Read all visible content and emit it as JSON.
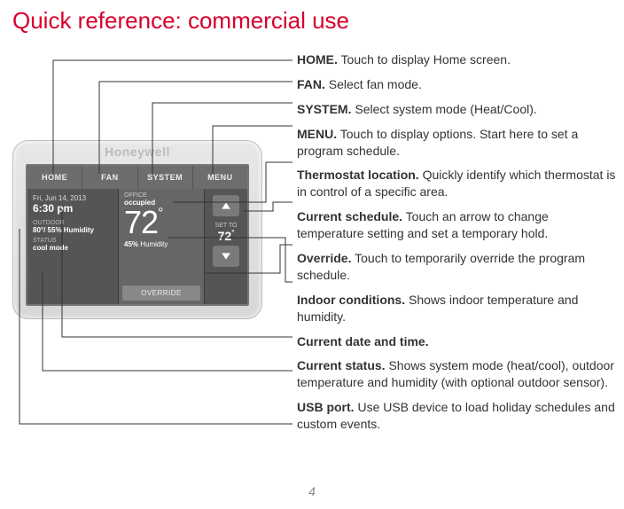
{
  "title": "Quick reference: commercial use",
  "page_number": "4",
  "device": {
    "brand": "Honeywell",
    "tabs": {
      "home": "HOME",
      "fan": "FAN",
      "system": "SYSTEM",
      "menu": "MENU"
    },
    "datetime": {
      "date": "Fri, Jun 14, 2013",
      "time": "6:30 pm"
    },
    "outdoor": {
      "label": "OUTDOOR",
      "value": "80°/ 55% Humidity"
    },
    "status": {
      "label": "STATUS",
      "value": "cool mode"
    },
    "location": {
      "label": "OFFICE",
      "value": "occupied"
    },
    "indoor_temp": "72",
    "humidity": {
      "value": "45%",
      "label": "Humidity"
    },
    "override": "OVERRIDE",
    "set_to": {
      "label": "SET TO",
      "value": "72"
    }
  },
  "descriptions": {
    "home": {
      "bold": "HOME.",
      "text": " Touch to display Home screen."
    },
    "fan": {
      "bold": "FAN.",
      "text": " Select fan mode."
    },
    "system": {
      "bold": "SYSTEM.",
      "text": " Select system mode (Heat/Cool)."
    },
    "menu": {
      "bold": "MENU.",
      "text": " Touch to display options. Start here to set a program schedule."
    },
    "location": {
      "bold": "Thermostat location.",
      "text": " Quickly identify which thermostat is in control of a specific area."
    },
    "schedule": {
      "bold": "Current schedule.",
      "text": " Touch an arrow to change temperature setting and set a temporary hold."
    },
    "override": {
      "bold": "Override.",
      "text": " Touch to temporarily override the program schedule."
    },
    "indoor": {
      "bold": "Indoor conditions.",
      "text": " Shows indoor temperature and humidity."
    },
    "datetime": {
      "bold": "Current date and time.",
      "text": ""
    },
    "status": {
      "bold": "Current status.",
      "text": " Shows system mode (heat/cool), outdoor temperature and humidity (with optional outdoor sensor)."
    },
    "usb": {
      "bold": "USB port.",
      "text": " Use USB device to load holiday schedules and custom events."
    }
  }
}
